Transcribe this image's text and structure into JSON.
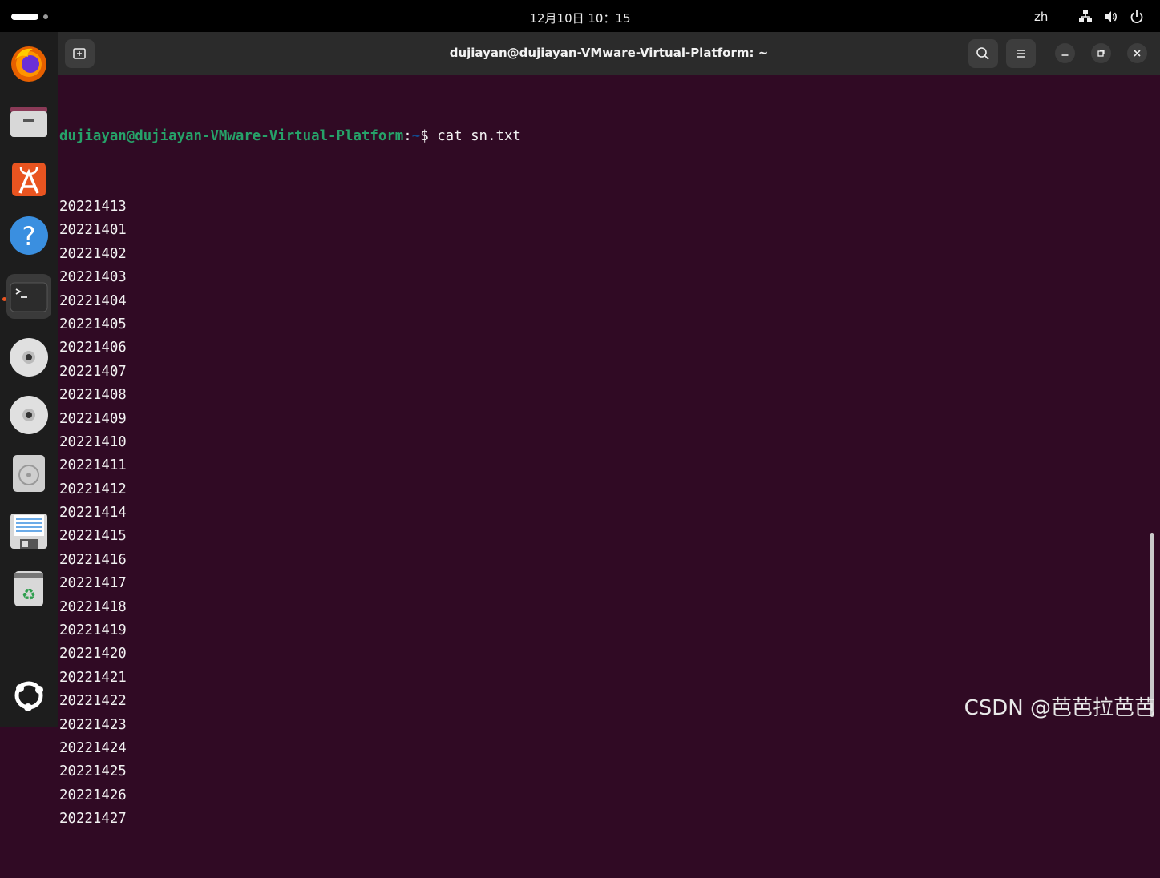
{
  "topbar": {
    "datetime": "12月10日  10：15",
    "language": "zh"
  },
  "dock": {
    "items": [
      {
        "icon": "firefox-icon"
      },
      {
        "icon": "files-icon"
      },
      {
        "icon": "app-center-icon"
      },
      {
        "icon": "help-icon"
      },
      {
        "icon": "terminal-icon",
        "active": true
      },
      {
        "icon": "disc-icon"
      },
      {
        "icon": "disc-icon"
      },
      {
        "icon": "disk-drive-icon"
      },
      {
        "icon": "floppy-icon"
      },
      {
        "icon": "trash-icon"
      },
      {
        "icon": "show-apps-icon"
      }
    ]
  },
  "window": {
    "title": "dujiayan@dujiayan-VMware-Virtual-Platform: ~"
  },
  "terminal": {
    "prompt_user": "dujiayan@dujiayan-VMware-Virtual-Platform",
    "prompt_colon": ":",
    "prompt_path": "~",
    "prompt_symbol": "$ ",
    "command": "cat sn.txt",
    "output": [
      "20221413",
      "20221401",
      "20221402",
      "20221403",
      "20221404",
      "20221405",
      "20221406",
      "20221407",
      "20221408",
      "20221409",
      "20221410",
      "20221411",
      "20221412",
      "20221414",
      "20221415",
      "20221416",
      "20221417",
      "20221418",
      "20221419",
      "20221420",
      "20221421",
      "20221422",
      "20221423",
      "20221424",
      "20221425",
      "20221426",
      "20221427"
    ]
  },
  "watermark": "CSDN @芭芭拉芭芭",
  "colors": {
    "terminal_bg": "#300a24",
    "prompt_user": "#26a269",
    "prompt_path": "#12488b",
    "accent": "#e95420"
  }
}
